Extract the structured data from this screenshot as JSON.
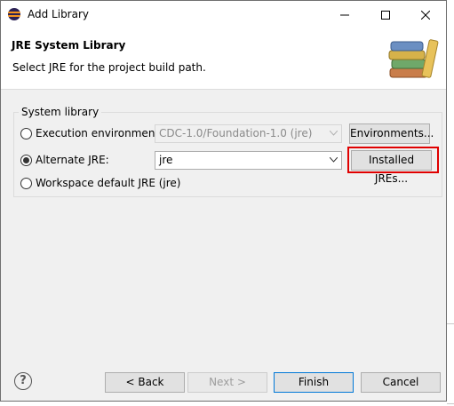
{
  "window": {
    "title": "Add Library",
    "icon": "eclipse-icon"
  },
  "header": {
    "title": "JRE System Library",
    "subtitle": "Select JRE for the project build path.",
    "icon": "library-books-icon"
  },
  "group": {
    "label": "System library",
    "options": [
      {
        "label": "Execution environment:",
        "selected": false
      },
      {
        "label": "Alternate JRE:",
        "selected": true
      },
      {
        "label": "Workspace default JRE (jre)",
        "selected": false
      }
    ],
    "execution_env_value": "CDC-1.0/Foundation-1.0 (jre)",
    "alternate_jre_value": "jre",
    "environments_button": "Environments...",
    "installed_jres_button": "Installed JREs..."
  },
  "footer": {
    "help": "?",
    "back": "< Back",
    "next": "Next >",
    "finish": "Finish",
    "cancel": "Cancel"
  },
  "colors": {
    "highlight": "#e00000",
    "default_button_border": "#0078d7"
  }
}
